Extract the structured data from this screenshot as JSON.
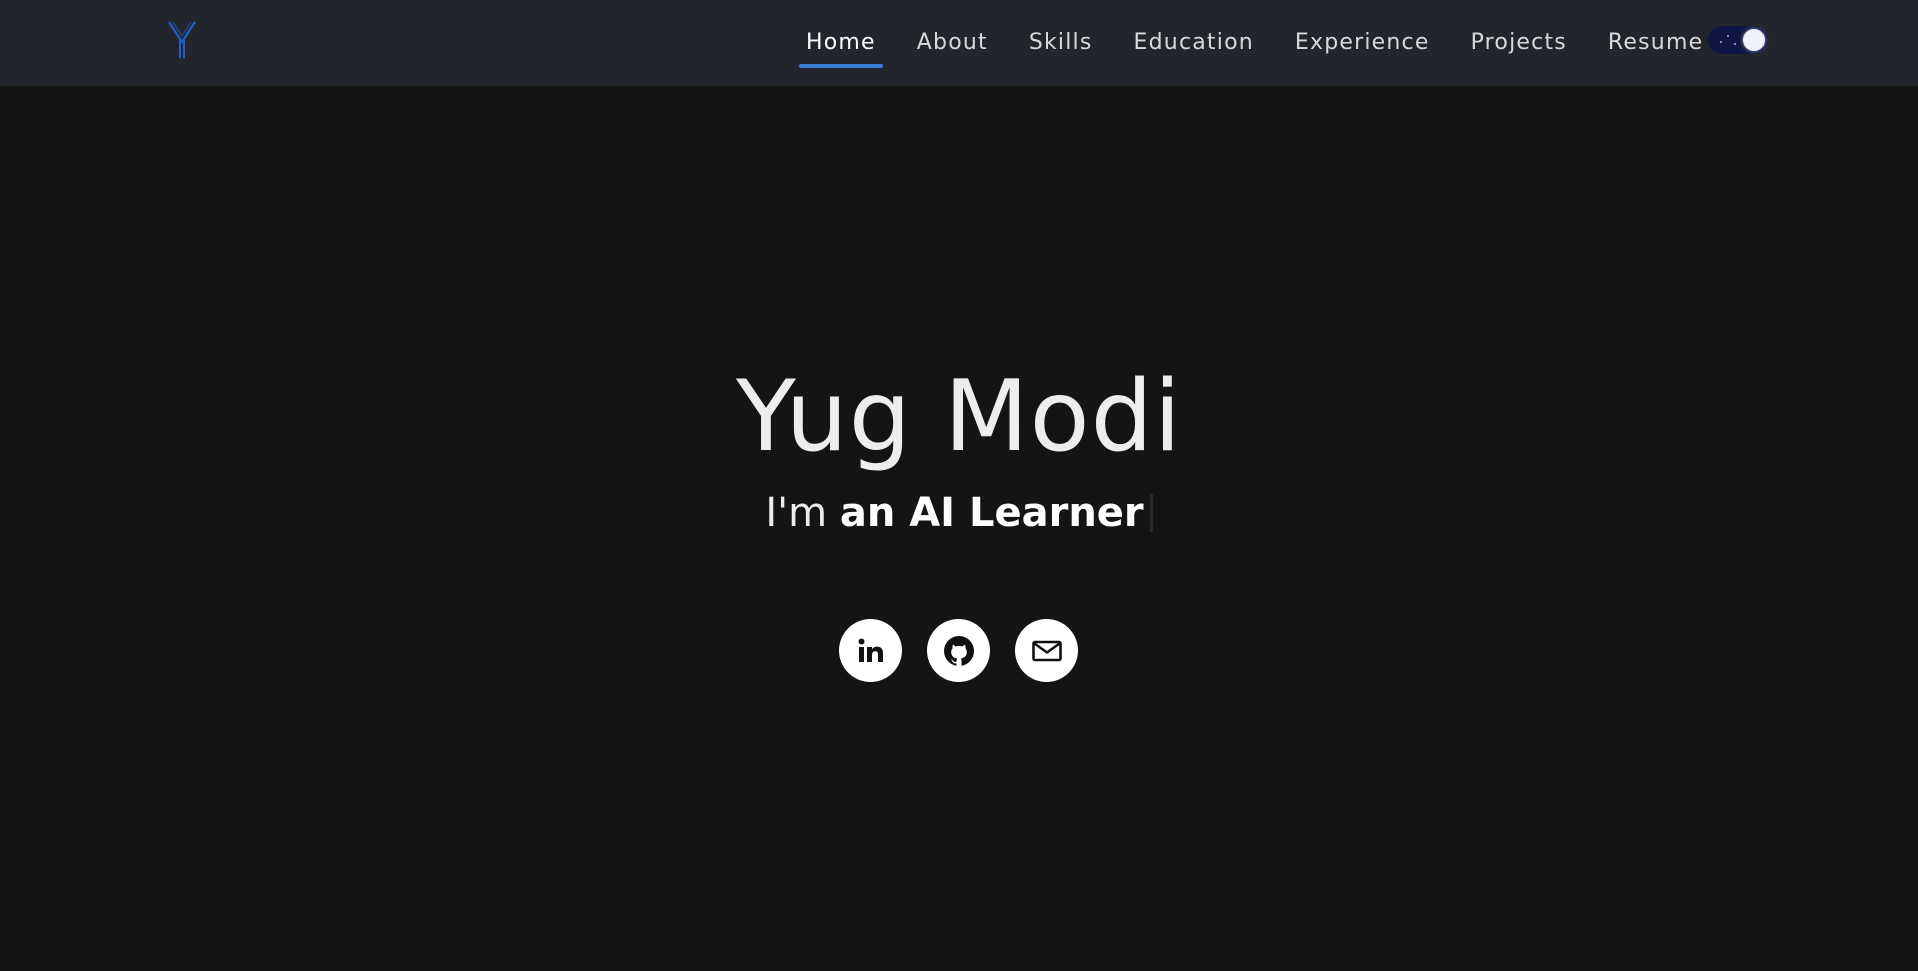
{
  "header": {
    "logo_letter": "Y",
    "logo_color": "#1f5fc4",
    "nav": [
      {
        "label": "Home",
        "active": true
      },
      {
        "label": "About",
        "active": false
      },
      {
        "label": "Skills",
        "active": false
      },
      {
        "label": "Education",
        "active": false
      },
      {
        "label": "Experience",
        "active": false
      },
      {
        "label": "Projects",
        "active": false
      },
      {
        "label": "Resume",
        "active": false
      }
    ],
    "theme_toggle": {
      "state": "dark",
      "icon": "moon-icon"
    }
  },
  "hero": {
    "name": "Yug Modi",
    "subtitle_prefix": "I'm",
    "subtitle_role": "an AI Learner"
  },
  "socials": [
    {
      "name": "linkedin",
      "icon": "linkedin-icon"
    },
    {
      "name": "github",
      "icon": "github-icon"
    },
    {
      "name": "email",
      "icon": "mail-icon"
    }
  ],
  "colors": {
    "background": "#141414",
    "navbar": "#22252b",
    "accent": "#3a7bd5",
    "text": "#ededed"
  }
}
